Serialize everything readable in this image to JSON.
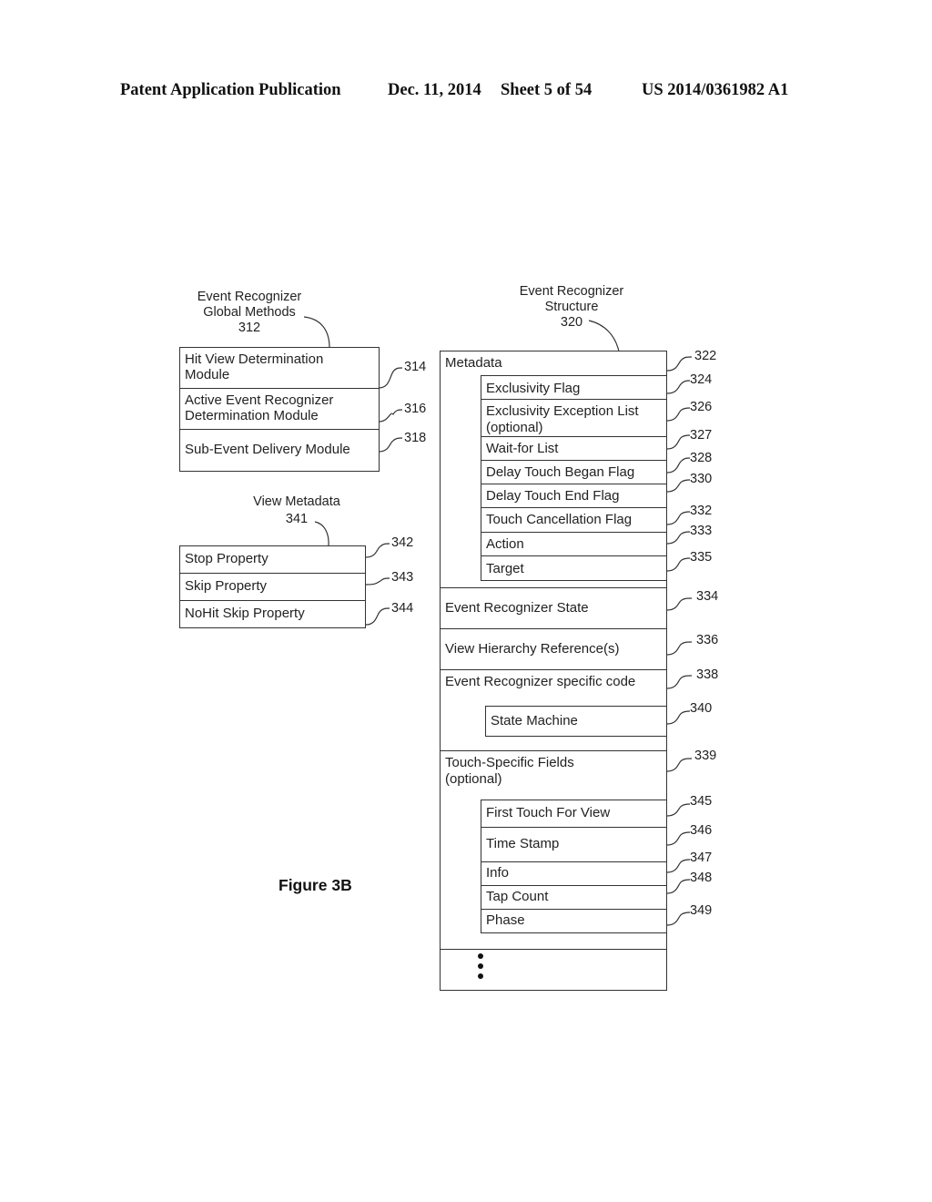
{
  "header": {
    "publication": "Patent Application Publication",
    "date": "Dec. 11, 2014",
    "sheet": "Sheet 5 of 54",
    "number": "US 2014/0361982 A1"
  },
  "figure_label": "Figure 3B",
  "global_methods": {
    "title_line1": "Event Recognizer",
    "title_line2": "Global Methods",
    "ref": "312",
    "rows": [
      {
        "line1": "Hit View Determination",
        "line2": "Module",
        "ref": "314"
      },
      {
        "line1": "Active Event Recognizer",
        "line2": "Determination Module",
        "ref": "316"
      },
      {
        "line1": "Sub-Event Delivery Module",
        "line2": "",
        "ref": "318"
      }
    ]
  },
  "view_metadata": {
    "title": "View Metadata",
    "ref": "341",
    "rows": [
      {
        "label": "Stop Property",
        "ref": "342"
      },
      {
        "label": "Skip Property",
        "ref": "343"
      },
      {
        "label": "NoHit Skip Property",
        "ref": "344"
      }
    ]
  },
  "structure": {
    "title_line1": "Event Recognizer",
    "title_line2": "Structure",
    "ref": "320",
    "metadata": {
      "label": "Metadata",
      "ref": "322",
      "fields": [
        {
          "line1": "Exclusivity Flag",
          "line2": "",
          "ref": "324"
        },
        {
          "line1": "Exclusivity Exception List",
          "line2": "(optional)",
          "ref": "326"
        },
        {
          "line1": "Wait-for List",
          "line2": "",
          "ref": "327"
        },
        {
          "line1": "Delay Touch Began Flag",
          "line2": "",
          "ref": "328"
        },
        {
          "line1": "Delay Touch End Flag",
          "line2": "",
          "ref": "330"
        },
        {
          "line1": "Touch Cancellation Flag",
          "line2": "",
          "ref": "332"
        },
        {
          "line1": "Action",
          "line2": "",
          "ref": "333"
        },
        {
          "line1": "Target",
          "line2": "",
          "ref": "335"
        }
      ]
    },
    "state": {
      "label": "Event Recognizer State",
      "ref": "334"
    },
    "hierarchy": {
      "label": "View Hierarchy Reference(s)",
      "ref": "336"
    },
    "code": {
      "label": "Event Recognizer specific code",
      "ref": "338",
      "state_machine": {
        "label": "State Machine",
        "ref": "340"
      }
    },
    "touch": {
      "line1": "Touch-Specific Fields",
      "line2": "(optional)",
      "ref": "339",
      "fields": [
        {
          "label": "First Touch For View",
          "ref": "345"
        },
        {
          "label": "Time Stamp",
          "ref": "346"
        },
        {
          "label": "Info",
          "ref": "347"
        },
        {
          "label": "Tap Count",
          "ref": "348"
        },
        {
          "label": "Phase",
          "ref": "349"
        }
      ]
    }
  }
}
